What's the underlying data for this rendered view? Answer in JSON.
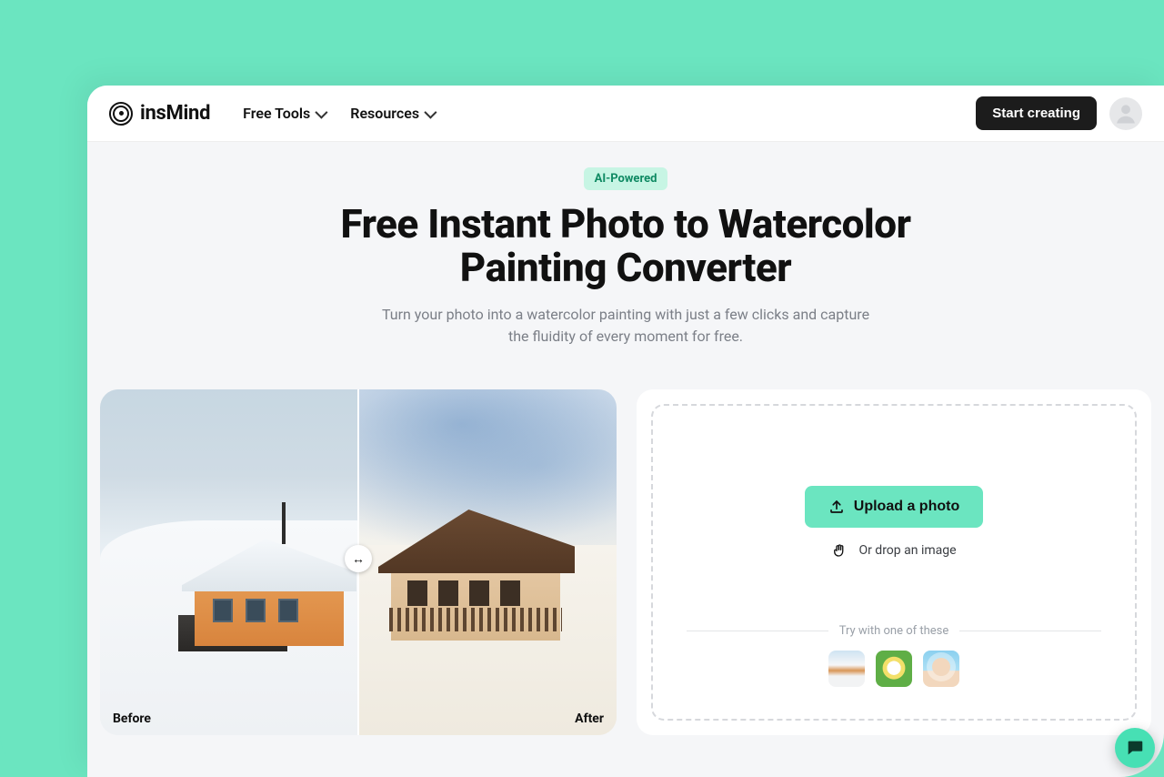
{
  "brand": {
    "name": "insMind"
  },
  "nav": {
    "free_tools": "Free Tools",
    "resources": "Resources"
  },
  "header": {
    "cta": "Start creating"
  },
  "hero": {
    "badge": "AI-Powered",
    "title": "Free Instant Photo to Watercolor Painting Converter",
    "subtitle": "Turn your photo into a watercolor painting with just a few clicks and capture the fluidity of every moment for free."
  },
  "compare": {
    "before_label": "Before",
    "after_label": "After"
  },
  "upload": {
    "button": "Upload a photo",
    "drop_hint": "Or drop an image",
    "samples_label": "Try with one of these"
  },
  "samples": [
    {
      "name": "snow-house"
    },
    {
      "name": "daisy-grass"
    },
    {
      "name": "woman-sunglasses"
    }
  ],
  "colors": {
    "accent": "#6be5c0",
    "badge_bg": "#c7f5e4",
    "badge_text": "#0f8a63",
    "cta_bg": "#1c1c1c"
  }
}
